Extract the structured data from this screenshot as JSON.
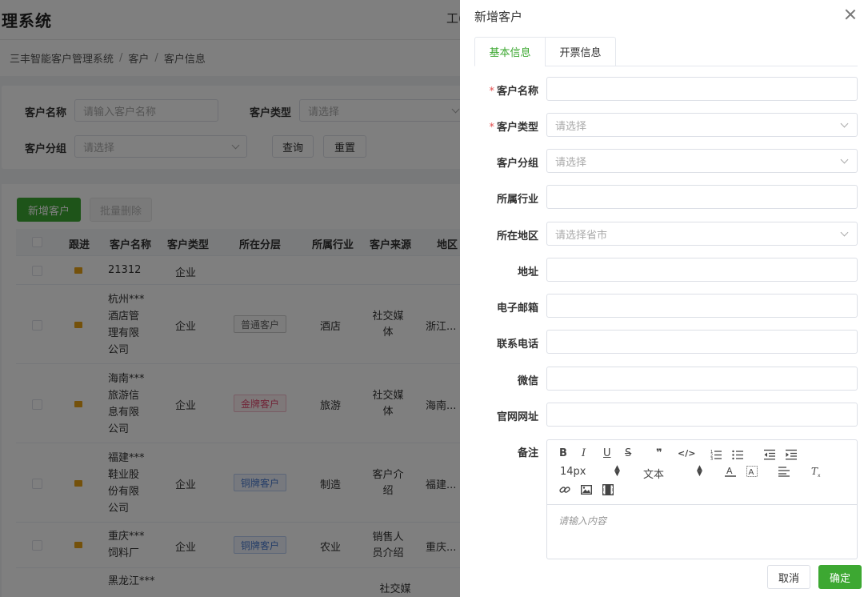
{
  "app": {
    "brand": "理系统",
    "top_right": "工(",
    "breadcrumb": [
      "三丰智能客户管理系统",
      "客户",
      "客户信息"
    ]
  },
  "filter": {
    "name_label": "客户名称",
    "name_placeholder": "请输入客户名称",
    "type_label": "客户类型",
    "type_placeholder": "请选择",
    "group_label": "客户分组",
    "group_placeholder": "请选择",
    "query": "查询",
    "reset": "重置"
  },
  "list": {
    "add": "新增客户",
    "bulk_delete": "批量删除",
    "headers": [
      "跟进",
      "客户名称",
      "客户类型",
      "所在分层",
      "所属行业",
      "客户来源",
      "地区"
    ],
    "rows": [
      {
        "name": "21312",
        "type": "企业",
        "tier": "",
        "industry": "",
        "source": "",
        "region": ""
      },
      {
        "name": "杭州***酒店管理有限公司",
        "type": "企业",
        "tier": "普通客户",
        "industry": "酒店",
        "source": "社交媒体",
        "region": "浙江..."
      },
      {
        "name": "海南***旅游信息有限公司",
        "type": "企业",
        "tier": "金牌客户",
        "industry": "旅游",
        "source": "社交媒体",
        "region": "海南..."
      },
      {
        "name": "福建***鞋业股份有限公司",
        "type": "企业",
        "tier": "铜牌客户",
        "industry": "制造",
        "source": "客户介绍",
        "region": "福建..."
      },
      {
        "name": "重庆***饲料厂",
        "type": "企业",
        "tier": "铜牌客户",
        "industry": "农业",
        "source": "销售人员介绍",
        "region": "重庆..."
      },
      {
        "name": "黑龙江***",
        "type": "企业",
        "tier": "",
        "industry": "",
        "source": "社交媒",
        "region": ""
      }
    ]
  },
  "drawer": {
    "title": "新增客户",
    "tabs": [
      "基本信息",
      "开票信息"
    ],
    "fields": {
      "name": {
        "label": "客户名称",
        "required": "*",
        "value": ""
      },
      "type": {
        "label": "客户类型",
        "required": "*",
        "placeholder": "请选择"
      },
      "group": {
        "label": "客户分组",
        "placeholder": "请选择"
      },
      "industry": {
        "label": "所属行业",
        "value": ""
      },
      "region": {
        "label": "所在地区",
        "placeholder": "请选择省市"
      },
      "address": {
        "label": "地址",
        "value": ""
      },
      "email": {
        "label": "电子邮箱",
        "value": ""
      },
      "phone": {
        "label": "联系电话",
        "value": ""
      },
      "wechat": {
        "label": "微信",
        "value": ""
      },
      "website": {
        "label": "官网网址",
        "value": ""
      },
      "remark": {
        "label": "备注"
      }
    },
    "editor": {
      "bold": "B",
      "italic": "I",
      "underline": "U",
      "strike": "S",
      "quote": "❞",
      "code": "</>",
      "font_size": "14px",
      "header": "文本",
      "placeholder": "请输入内容"
    },
    "cancel": "取消",
    "confirm": "确定"
  },
  "colors": {
    "accent": "#3da832",
    "required": "#e24d4d"
  }
}
